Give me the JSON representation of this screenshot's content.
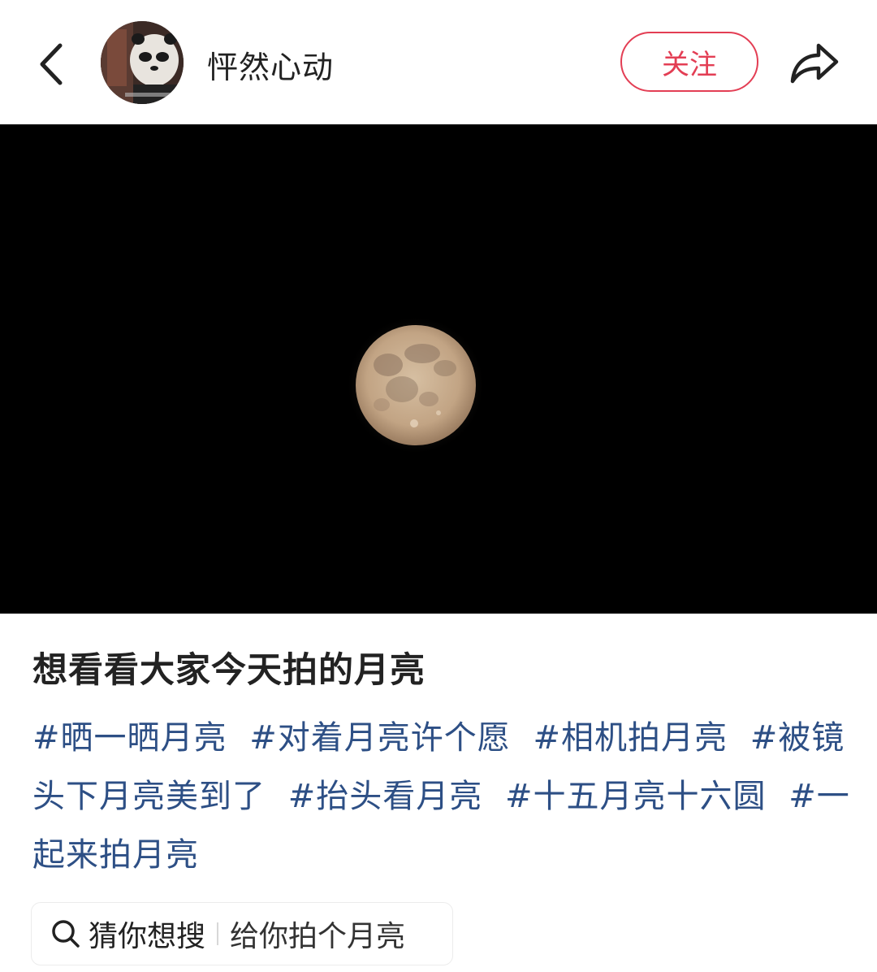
{
  "header": {
    "username": "怦然心动",
    "follow_label": "关注"
  },
  "post": {
    "title": "想看看大家今天拍的月亮",
    "tags": [
      "#晒一晒月亮",
      "#对着月亮许个愿",
      "#相机拍月亮",
      "#被镜头下月亮美到了",
      "#抬头看月亮",
      "#十五月亮十六圆",
      "#一起来拍月亮"
    ]
  },
  "search": {
    "label": "猜你想搜",
    "query": "给你拍个月亮"
  },
  "icons": {
    "back": "chevron-left-icon",
    "share": "share-arrow-icon",
    "search": "search-icon"
  },
  "colors": {
    "accent": "#e33e54",
    "tag": "#2d4f85",
    "photo_bg": "#000000",
    "moon": "#c7ad8e"
  }
}
